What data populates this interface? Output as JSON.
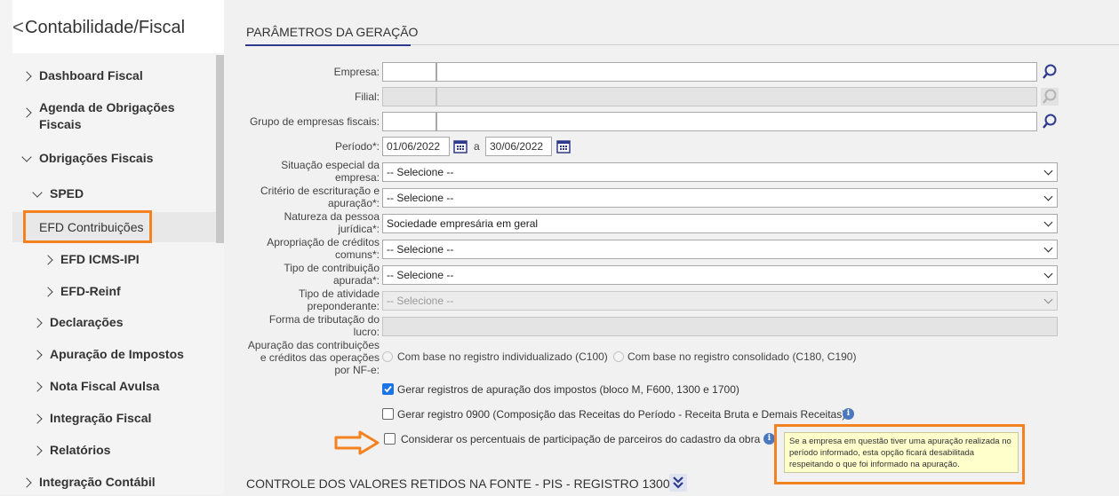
{
  "sidebar": {
    "back_glyph": "<",
    "title": "Contabilidade/Fiscal",
    "items": {
      "dashboard": "Dashboard Fiscal",
      "agenda_l1": "Agenda de Obrigações",
      "agenda_l2": "Fiscais",
      "obrigacoes": "Obrigações Fiscais",
      "sped": "SPED",
      "efd_contrib": "EFD Contribuições",
      "efd_icms": "EFD ICMS-IPI",
      "efd_reinf": "EFD-Reinf",
      "declaracoes": "Declarações",
      "apuracao": "Apuração de Impostos",
      "nota": "Nota Fiscal Avulsa",
      "integracao_fiscal": "Integração Fiscal",
      "relatorios": "Relatórios",
      "integracao_contabil": "Integração Contábil"
    }
  },
  "main": {
    "section_title": "PARÂMETROS DA GERAÇÃO",
    "labels": {
      "empresa": "Empresa:",
      "filial": "Filial:",
      "grupo": "Grupo de empresas fiscais:",
      "periodo": "Período*:",
      "periodo_sep": "a",
      "situacao_l1": "Situação especial da",
      "situacao_l2": "empresa:",
      "criterio_l1": "Critério de escrituração e",
      "criterio_l2": "apuração*:",
      "natureza_l1": "Natureza da pessoa",
      "natureza_l2": "jurídica*:",
      "apropriacao_l1": "Apropriação de créditos",
      "apropriacao_l2": "comuns*:",
      "tipo_contrib_l1": "Tipo de contribuição",
      "tipo_contrib_l2": "apurada*:",
      "tipo_ativ_l1": "Tipo de atividade",
      "tipo_ativ_l2": "preponderante:",
      "forma_l1": "Forma de tributação do",
      "forma_l2": "lucro:",
      "apur_l1": "Apuração das contribuições",
      "apur_l2": "e créditos das operações",
      "apur_l3": "por NF-e:"
    },
    "values": {
      "periodo_inicio": "01/06/2022",
      "periodo_fim": "30/06/2022",
      "situacao": "-- Selecione --",
      "criterio": "-- Selecione --",
      "natureza": "Sociedade empresária em geral",
      "apropriacao": "-- Selecione --",
      "tipo_contrib": "-- Selecione --",
      "tipo_ativ": "-- Selecione --"
    },
    "radios": {
      "individualizado": "Com base no registro individualizado (C100)",
      "consolidado": "Com base no registro consolidado (C180, C190)"
    },
    "checkboxes": {
      "gerar_apuracao": "Gerar registros de apuração dos impostos (bloco M, F600, 1300 e 1700)",
      "gerar_0900": "Gerar registro 0900 (Composição das Receitas do Período - Receita Bruta e Demais Receitas)",
      "considerar": "Considerar os percentuais de participação de parceiros do cadastro da obra"
    },
    "checked": {
      "gerar_apuracao": true,
      "gerar_0900": false,
      "considerar": false
    },
    "tooltip": "Se a empresa em questão tiver uma apuração realizada no período informado, esta opção ficará desabilitada respeitando o que foi informado na apuração.",
    "info_glyph": "i",
    "section2_title": "CONTROLE DOS VALORES RETIDOS NA FONTE - PIS - REGISTRO 1300"
  },
  "colors": {
    "accent_orange": "#f58220",
    "nav_blue": "#2e3a8c",
    "checkbox_blue": "#1a73e8"
  }
}
